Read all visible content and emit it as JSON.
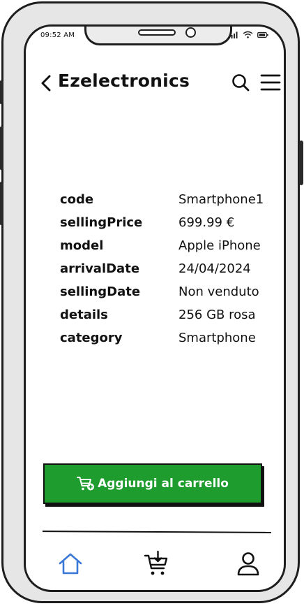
{
  "status_bar": {
    "time": "09:52 AM"
  },
  "header": {
    "title": "Ezelectronics"
  },
  "product": {
    "fields": [
      {
        "key": "code",
        "value": "Smartphone1"
      },
      {
        "key": "sellingPrice",
        "value": "699.99 €"
      },
      {
        "key": "model",
        "value": "Apple iPhone"
      },
      {
        "key": "arrivalDate",
        "value": "24/04/2024"
      },
      {
        "key": "sellingDate",
        "value": "Non venduto"
      },
      {
        "key": "details",
        "value": "256 GB rosa"
      },
      {
        "key": "category",
        "value": "Smartphone"
      }
    ]
  },
  "actions": {
    "add_to_cart_label": "Aggiungi al carrello"
  },
  "colors": {
    "button_green": "#1f9c2e",
    "active_nav_blue": "#3a78d8"
  },
  "nav": {
    "items": [
      {
        "icon": "home-icon",
        "active": true
      },
      {
        "icon": "cart-download-icon",
        "active": false
      },
      {
        "icon": "user-icon",
        "active": false
      }
    ]
  }
}
